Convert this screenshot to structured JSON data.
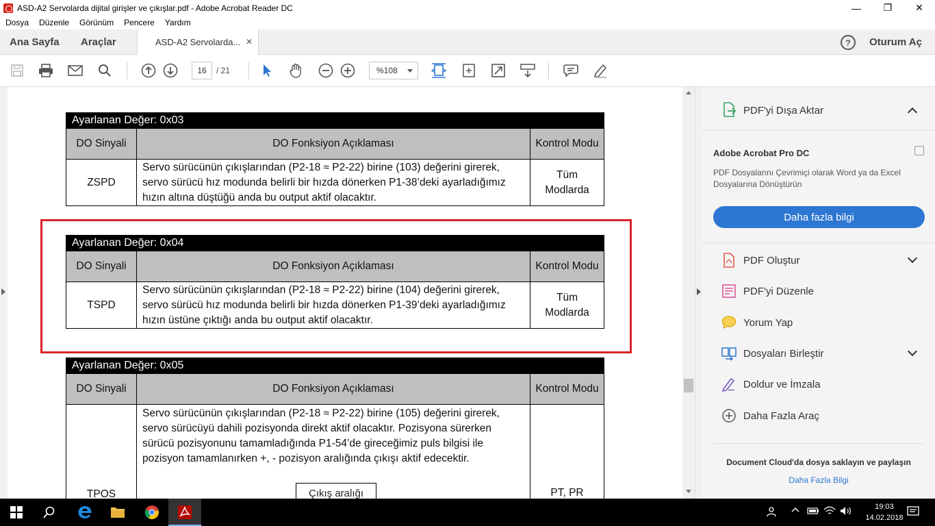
{
  "window": {
    "title": "ASD-A2 Servolarda dijital girişler ve çıkışlar.pdf - Adobe Acrobat Reader DC",
    "controls": [
      "—",
      "❐",
      "✕"
    ]
  },
  "menu": [
    "Dosya",
    "Düzenle",
    "Görünüm",
    "Pencere",
    "Yardım"
  ],
  "tabs": {
    "home": "Ana Sayfa",
    "tools": "Araçlar",
    "document": "ASD-A2 Servolarda...",
    "close": "✕",
    "help": "?",
    "login": "Oturum Aç"
  },
  "toolbar": {
    "page_current": "16",
    "page_total": "/ 21",
    "zoom": "%108"
  },
  "document": {
    "tables": [
      {
        "header": "Ayarlanan Değer: 0x03",
        "col1": "DO Sinyali",
        "col2": "DO Fonksiyon Açıklaması",
        "col3": "Kontrol Modu",
        "signal": "ZSPD",
        "description": "Servo sürücünün çıkışlarından (P2-18 ≈ P2-22) birine (103) değerini girerek, servo sürücü hız modunda belirli bir hızda dönerken P1-38’deki ayarladığımız hızın altına düştüğü anda bu output aktif olacaktır.",
        "mode": "Tüm Modlarda"
      },
      {
        "header": "Ayarlanan Değer: 0x04",
        "col1": "DO Sinyali",
        "col2": "DO Fonksiyon Açıklaması",
        "col3": "Kontrol Modu",
        "signal": "TSPD",
        "description": "Servo sürücünün çıkışlarından (P2-18 ≈ P2-22) birine (104) değerini girerek, servo sürücü hız modunda belirli bir hızda dönerken P1-39’deki ayarladığımız hızın üstüne çıktığı anda bu output aktif olacaktır.",
        "mode": "Tüm Modlarda"
      },
      {
        "header": "Ayarlanan Değer: 0x05",
        "col1": "DO Sinyali",
        "col2": "DO Fonksiyon Açıklaması",
        "col3": "Kontrol Modu",
        "signal": "TPOS",
        "description": "Servo sürücünün çıkışlarından (P2-18 ≈ P2-22) birine (105) değerini girerek, servo sürücüyü dahili pozisyonda direkt aktif olacaktır. Pozisyona sürerken sürücü pozisyonunu tamamladığında P1-54’de gireceğimiz puls bilgisi ile pozisyon tamamlanırken +, - pozisyon aralığında çıkışı aktif edecektir.",
        "mode": "PT, PR",
        "inner_box": "Çıkış aralığı"
      }
    ]
  },
  "right_pane": {
    "export_label": "PDF'yi Dışa Aktar",
    "promo_title": "Adobe Acrobat Pro DC",
    "promo_text": "PDF Dosyalarını Çevrimiçi olarak Word ya da Excel Dosyalarına Dönüştürün",
    "promo_button": "Daha fazla bilgi",
    "tools": [
      {
        "label": "PDF Oluştur",
        "icon": "create-pdf-icon",
        "color": "#e05a4e"
      },
      {
        "label": "PDF'yi Düzenle",
        "icon": "edit-pdf-icon",
        "color": "#e0569a"
      },
      {
        "label": "Yorum Yap",
        "icon": "comment-icon",
        "color": "#f2b600"
      },
      {
        "label": "Dosyaları Birleştir",
        "icon": "combine-files-icon",
        "color": "#2d76d2"
      },
      {
        "label": "Doldur ve İmzala",
        "icon": "fill-sign-icon",
        "color": "#7b5fc7"
      },
      {
        "label": "Daha Fazla Araç",
        "icon": "more-tools-icon",
        "color": "#555555"
      }
    ],
    "cloud_text": "Document Cloud'da dosya saklayın ve paylaşın",
    "cloud_link": "Daha Fazla Bilgi"
  },
  "taskbar": {
    "time": "19:03",
    "date": "14.02.2018"
  },
  "colors": {
    "accent": "#2d76d2",
    "highlight_box": "#d8232a",
    "table_header": "#000000",
    "table_subheader": "#bfbfbf"
  }
}
